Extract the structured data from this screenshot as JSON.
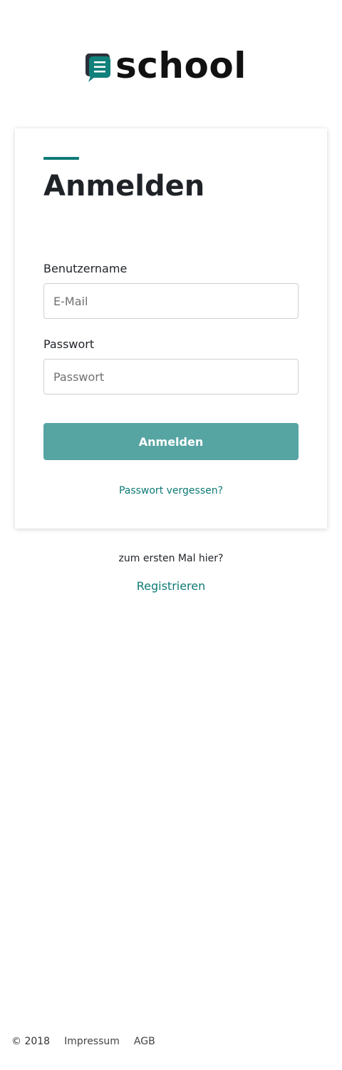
{
  "brand": {
    "name": "school",
    "icon": "chat-bubble-lines-icon",
    "color": "#0d7a76"
  },
  "login": {
    "title": "Anmelden",
    "username_label": "Benutzername",
    "username_placeholder": "E-Mail",
    "password_label": "Passwort",
    "password_placeholder": "Passwort",
    "submit_label": "Anmelden",
    "forgot_password": "Passwort vergessen?",
    "button_color": "#57a5a3"
  },
  "register": {
    "prompt": "zum ersten Mal hier?",
    "link": "Registrieren"
  },
  "footer": {
    "copyright": "© 2018",
    "links": [
      "Impressum",
      "AGB"
    ]
  }
}
